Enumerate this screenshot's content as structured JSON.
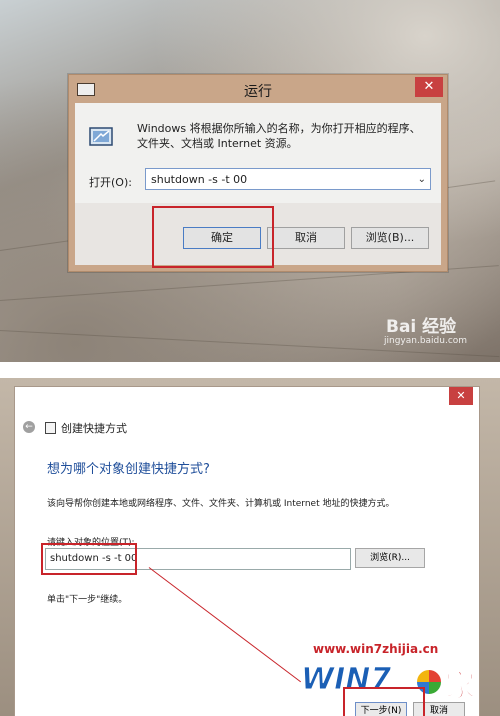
{
  "run_dialog": {
    "title": "运行",
    "close_glyph": "✕",
    "description": "Windows 将根据你所输入的名称，为你打开相应的程序、文件夹、文档或 Internet 资源。",
    "open_label": "打开(O):",
    "open_value": "shutdown -s -t 00",
    "dropdown_glyph": "⌄",
    "ok_label": "确定",
    "cancel_label": "取消",
    "browse_label": "浏览(B)..."
  },
  "watermark_top": {
    "logo": "Bai 经验",
    "url": "jingyan.baidu.com"
  },
  "shortcut_wizard": {
    "close_glyph": "✕",
    "back_glyph": "←",
    "title": "创建快捷方式",
    "heading": "想为哪个对象创建快捷方式?",
    "description": "该向导帮你创建本地或网络程序、文件、文件夹、计算机或 Internet 地址的快捷方式。",
    "location_label": "请键入对象的位置(T):",
    "location_value": "shutdown -s -t 00",
    "browse_label": "浏览(R)...",
    "hint": "单击\"下一步\"继续。",
    "next_label": "下一步(N)",
    "cancel_label": "取消"
  },
  "watermark_bottom": {
    "url": "www.win7zhijia.cn",
    "brand": "WIN7",
    "brand_suffix": "家"
  },
  "colors": {
    "highlight": "#c8242a",
    "heading_blue": "#1f4e9a",
    "close_red": "#c84040"
  },
  "icons": [
    "run-app-icon",
    "close-icon",
    "dropdown-icon",
    "back-arrow-icon",
    "shortcut-icon",
    "windows-logo-icon"
  ]
}
